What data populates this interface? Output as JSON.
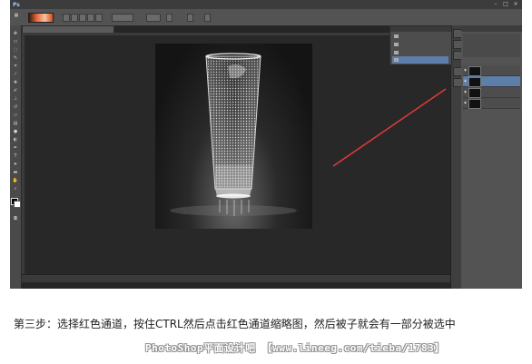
{
  "app": {
    "logo": "Ps"
  },
  "menubar": {
    "items": [
      "",
      "",
      "",
      "",
      "",
      "",
      "",
      "",
      "",
      ""
    ]
  },
  "document": {
    "tab_title": ""
  },
  "statusbar": {
    "zoom": "",
    "info": ""
  },
  "channels_panel": {
    "tabs": [
      "",
      "",
      ""
    ],
    "rows": [
      {
        "name": "",
        "shortcut": ""
      },
      {
        "name": "",
        "shortcut": ""
      },
      {
        "name": "",
        "shortcut": ""
      },
      {
        "name": "",
        "shortcut": ""
      }
    ]
  },
  "popup_panel": {
    "rows": [
      "",
      "",
      "",
      ""
    ]
  },
  "caption": {
    "text": "第三步：选择红色通道，按住CTRL然后点击红色通道缩略图，然后被子就会有一部分被选中"
  },
  "watermark": {
    "text": "PhotoShop平面设计吧 【www.lineeg.com/tieba/1783】"
  },
  "colors": {
    "accent": "#e13a3a",
    "selection": "#5d7ea8",
    "workspace": "#262626"
  }
}
